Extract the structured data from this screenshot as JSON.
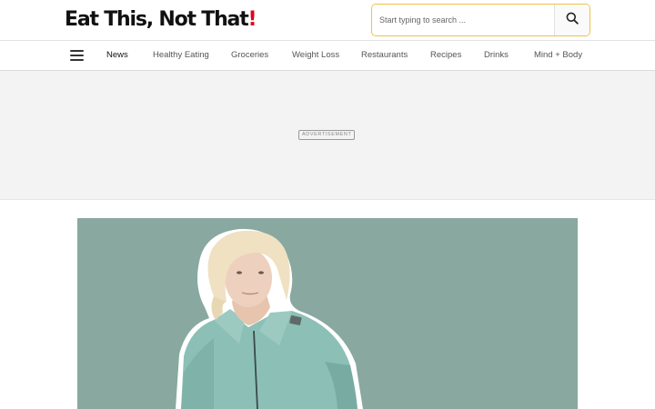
{
  "header": {
    "logo_main": "Eat This, Not That",
    "logo_bang": "!"
  },
  "search": {
    "placeholder": "Start typing to search ...",
    "button_icon": "search-icon"
  },
  "nav": {
    "menu_icon": "hamburger-menu-icon",
    "items": [
      {
        "label": "News",
        "active": true
      },
      {
        "label": "Healthy Eating"
      },
      {
        "label": "Groceries"
      },
      {
        "label": "Weight Loss"
      },
      {
        "label": "Restaurants"
      },
      {
        "label": "Recipes"
      },
      {
        "label": "Drinks"
      },
      {
        "label": "Mind + Body"
      }
    ]
  },
  "ad": {
    "label": "ADVERTISEMENT"
  },
  "colors": {
    "logo_accent": "#e3001b",
    "search_border": "#f0c14b",
    "hero_background": "#88a8a0",
    "jacket": "#8cc0b6"
  }
}
